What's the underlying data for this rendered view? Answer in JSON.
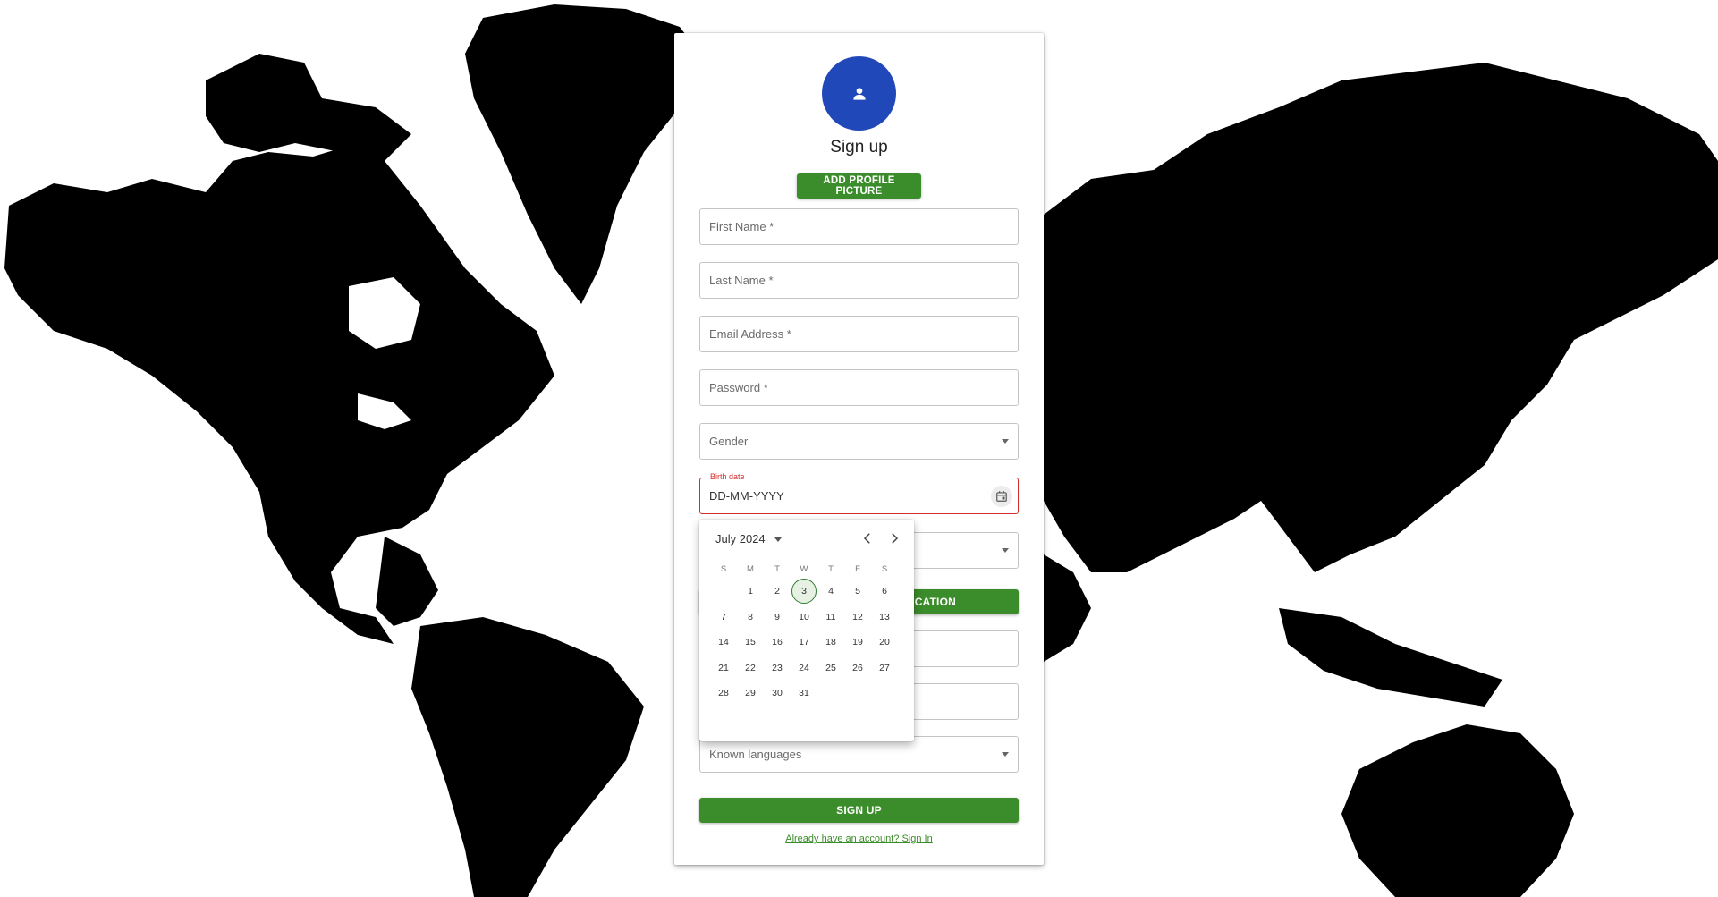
{
  "signup": {
    "title": "Sign up",
    "add_picture_label": "ADD PROFILE PICTURE",
    "fields": {
      "first_name": "First Name *",
      "last_name": "Last Name *",
      "email": "Email Address *",
      "password": "Password *",
      "gender": "Gender",
      "birth_label": "Birth date",
      "birth_value": "DD-MM-YYYY",
      "known_languages": "Known languages"
    },
    "verify_label": "ICATION",
    "submit_label": "SIGN UP",
    "signin_link": "Already have an account? Sign In"
  },
  "date_picker": {
    "month_label": "July 2024",
    "weekdays": [
      "S",
      "M",
      "T",
      "W",
      "T",
      "F",
      "S"
    ],
    "weeks": [
      [
        "",
        "1",
        "2",
        "3",
        "4",
        "5",
        "6"
      ],
      [
        "7",
        "8",
        "9",
        "10",
        "11",
        "12",
        "13"
      ],
      [
        "14",
        "15",
        "16",
        "17",
        "18",
        "19",
        "20"
      ],
      [
        "21",
        "22",
        "23",
        "24",
        "25",
        "26",
        "27"
      ],
      [
        "28",
        "29",
        "30",
        "31",
        "",
        "",
        ""
      ]
    ],
    "today": "3"
  },
  "colors": {
    "accent": "#3b8c2a",
    "avatar": "#2148b8",
    "error": "#d32f2f"
  }
}
